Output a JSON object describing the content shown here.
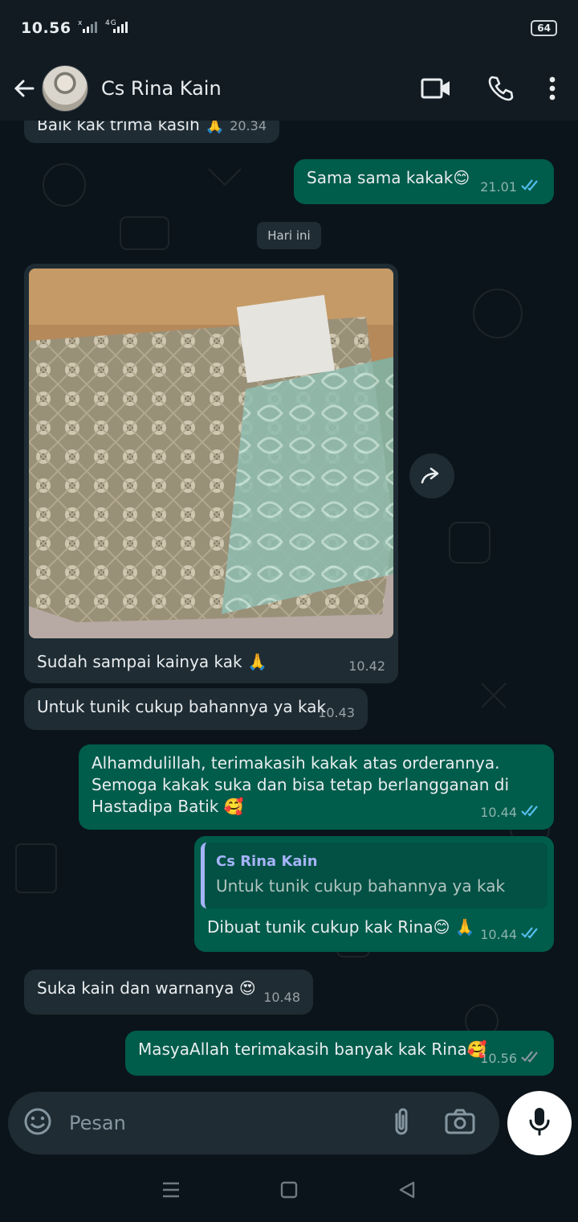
{
  "status": {
    "time": "10.56",
    "signal": "4G",
    "battery": "64"
  },
  "header": {
    "contact_name": "Cs Rina Kain"
  },
  "date_chip": "Hari ini",
  "messages": [
    {
      "dir": "in",
      "text": "Baik kak trima kasih 🙏",
      "time": "20.34"
    },
    {
      "dir": "out",
      "text": "Sama sama kakak😊",
      "time": "21.01"
    },
    {
      "dir": "in",
      "text": "Sudah sampai kainya kak 🙏",
      "time": "10.42",
      "has_photo": true
    },
    {
      "dir": "in",
      "text": "Untuk tunik cukup bahannya ya kak",
      "time": "10.43"
    },
    {
      "dir": "out",
      "text": "Alhamdulillah, terimakasih kakak atas orderannya. Semoga kakak suka dan bisa tetap berlangganan di Hastadipa Batik 🥰",
      "time": "10.44"
    },
    {
      "dir": "out",
      "quote_name": "Cs Rina Kain",
      "quote_text": "Untuk tunik cukup bahannya ya kak",
      "text": "Dibuat tunik cukup kak Rina😊 🙏",
      "time": "10.44"
    },
    {
      "dir": "in",
      "text": "Suka kain dan warnanya 😍",
      "time": "10.48"
    },
    {
      "dir": "out",
      "text": "MasyaAllah terimakasih banyak kak Rina🥰",
      "time": "10.56"
    }
  ],
  "composer": {
    "placeholder": "Pesan"
  },
  "colors": {
    "incoming": "#1f2c34",
    "outgoing": "#005c4b",
    "read_tick": "#53bdeb",
    "background": "#0b141a"
  }
}
